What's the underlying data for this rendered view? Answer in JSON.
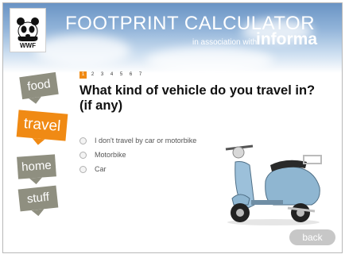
{
  "header": {
    "title": "FOOTPRINT CALCULATOR",
    "partner_prefix": "in association with",
    "partner_name": "informa",
    "logo_text": "WWF"
  },
  "sidebar": {
    "items": [
      {
        "label": "food",
        "active": false
      },
      {
        "label": "travel",
        "active": true
      },
      {
        "label": "home",
        "active": false
      },
      {
        "label": "stuff",
        "active": false
      }
    ]
  },
  "steps": [
    "1",
    "2",
    "3",
    "4",
    "5",
    "6",
    "7"
  ],
  "current_step": 1,
  "question": {
    "text": "What kind of vehicle do you travel in? (if any)",
    "options": [
      "I don't travel by car or motorbike",
      "Motorbike",
      "Car"
    ]
  },
  "footer": {
    "back_label": "back"
  },
  "colors": {
    "accent": "#f08a14",
    "tag_gray": "#8f8f80",
    "sky": "#6a93c4"
  },
  "icons": {
    "logo": "panda-icon",
    "illustration": "scooter-icon"
  }
}
